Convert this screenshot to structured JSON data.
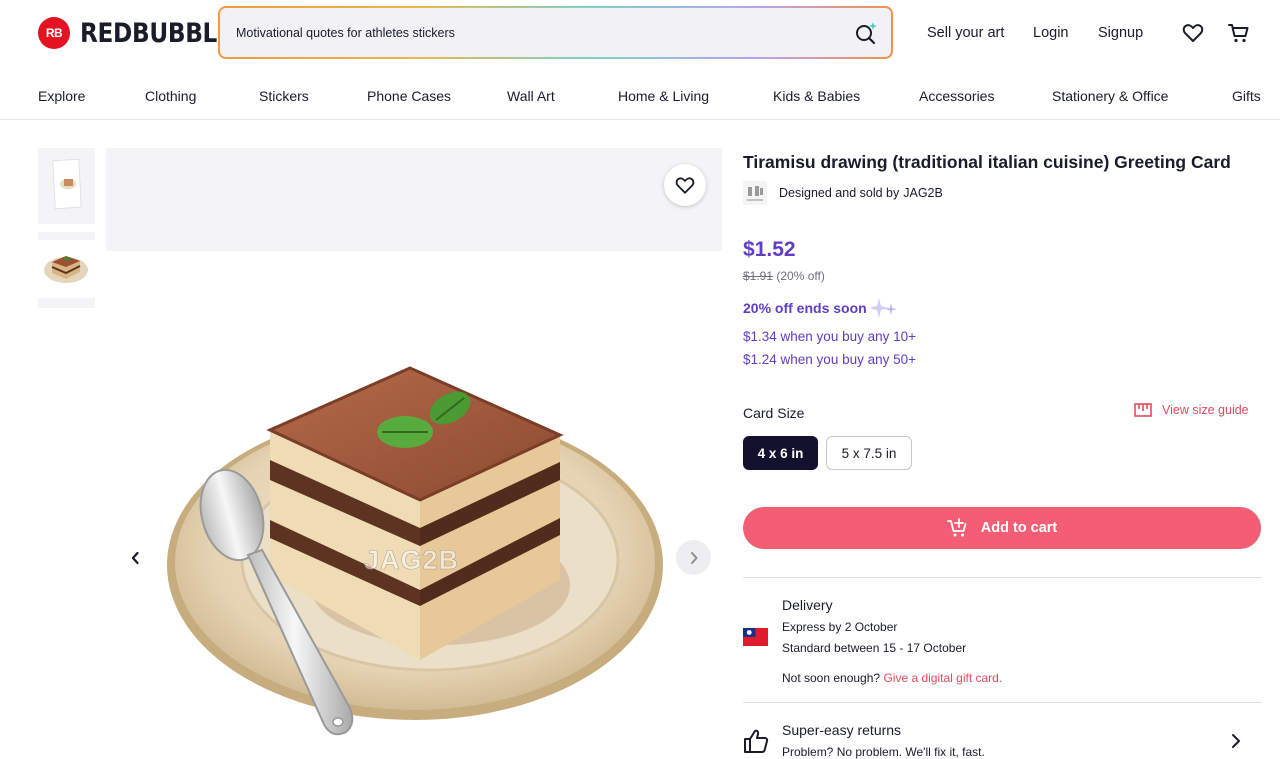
{
  "brand": {
    "logo_badge": "RB",
    "name": "REDBUBBLE"
  },
  "search": {
    "value": "Motivational quotes for athletes stickers",
    "icon": "search-sparkle-icon"
  },
  "header_links": {
    "sell": "Sell your art",
    "login": "Login",
    "signup": "Signup"
  },
  "nav": {
    "items": [
      "Explore",
      "Clothing",
      "Stickers",
      "Phone Cases",
      "Wall Art",
      "Home & Living",
      "Kids & Babies",
      "Accessories",
      "Stationery & Office",
      "Gifts"
    ]
  },
  "gallery": {
    "watermark": "JAG2B"
  },
  "product": {
    "title": "Tiramisu drawing (traditional italian cuisine) Greeting Card",
    "designed_by_prefix": "Designed and sold by",
    "artist": "JAG2B",
    "price": "$1.52",
    "old_price": "$1.91",
    "discount_text": "(20% off)",
    "sale_text": "20% off ends soon",
    "bulk_10": "$1.34 when you buy any 10+",
    "bulk_50": "$1.24 when you buy any 50+",
    "size_label": "Card Size",
    "size_guide": "View size guide",
    "sizes": [
      "4 x 6 in",
      "5 x 7.5 in"
    ],
    "selected_size": "4 x 6 in",
    "add_to_cart": "Add to cart"
  },
  "delivery": {
    "title": "Delivery",
    "express": "Express by 2 October",
    "standard": "Standard between 15 - 17 October",
    "not_soon": "Not soon enough?",
    "gift_link": "Give a digital gift card."
  },
  "returns": {
    "title": "Super-easy returns",
    "subtitle": "Problem? No problem. We'll fix it, fast."
  },
  "colors": {
    "brand_red": "#e41321",
    "price_purple": "#5f3dc4",
    "cart_pink": "#f35e74",
    "selected_dark": "#14112e"
  }
}
